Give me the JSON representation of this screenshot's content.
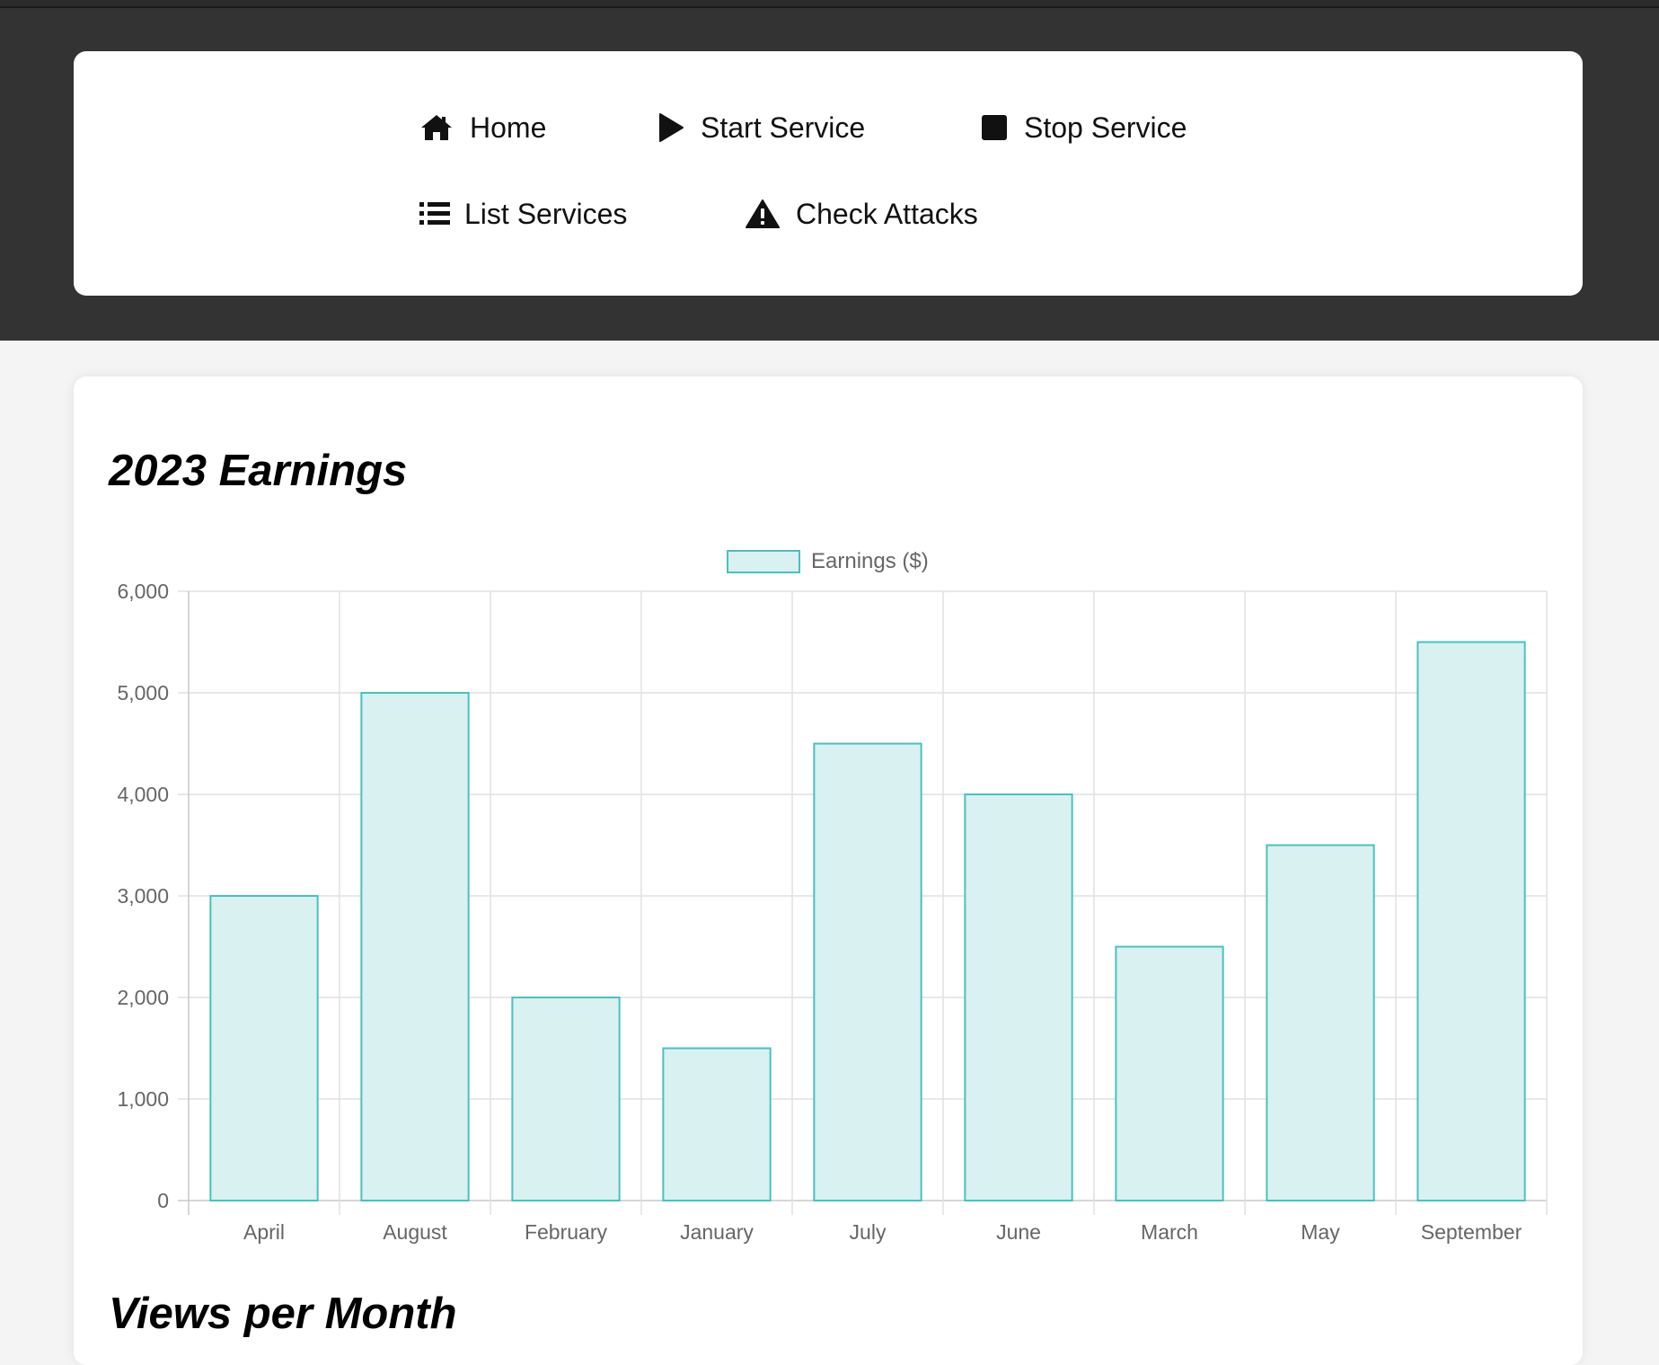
{
  "nav": {
    "items": [
      {
        "label": "Home",
        "icon": "home-icon"
      },
      {
        "label": "Start Service",
        "icon": "play-icon"
      },
      {
        "label": "Stop Service",
        "icon": "stop-icon"
      },
      {
        "label": "List Services",
        "icon": "list-icon"
      },
      {
        "label": "Check Attacks",
        "icon": "warning-icon"
      }
    ]
  },
  "main": {
    "chart_title": "2023 Earnings",
    "next_title": "Views per Month"
  },
  "colors": {
    "header_bg": "#333333",
    "bar_fill": "#d9f1f1",
    "bar_border": "#4bc0c0",
    "grid": "#e1e1e1",
    "tick_text": "#666666"
  },
  "chart_data": {
    "type": "bar",
    "title": "2023 Earnings",
    "categories": [
      "April",
      "August",
      "February",
      "January",
      "July",
      "June",
      "March",
      "May",
      "September"
    ],
    "series": [
      {
        "name": "Earnings ($)",
        "values": [
          3000,
          5000,
          2000,
          1500,
          4500,
          4000,
          2500,
          3500,
          5500
        ]
      }
    ],
    "ylim": [
      0,
      6000
    ],
    "yticks": [
      0,
      1000,
      2000,
      3000,
      4000,
      5000,
      6000
    ],
    "ytick_labels": [
      "0",
      "1,000",
      "2,000",
      "3,000",
      "4,000",
      "5,000",
      "6,000"
    ],
    "grid": true,
    "legend_position": "top-center"
  }
}
